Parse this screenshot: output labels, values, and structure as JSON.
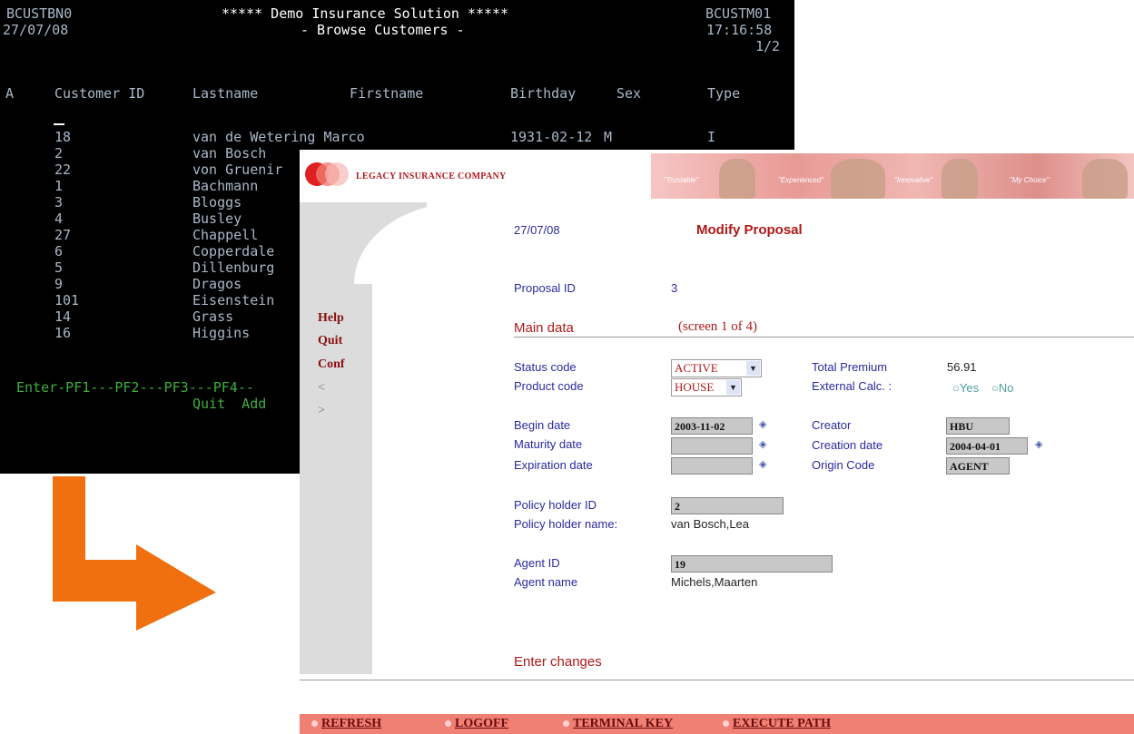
{
  "terminal": {
    "program_id": "BCUSTBN0",
    "date": "27/07/08",
    "title": "***** Demo Insurance Solution *****",
    "subtitle": "- Browse Customers -",
    "screen_id": "BCUSTM01",
    "time": "17:16:58",
    "page": "1/2",
    "headers": {
      "action": "A",
      "customer_id": "Customer ID",
      "lastname": "Lastname",
      "firstname": "Firstname",
      "birthday": "Birthday",
      "sex": "Sex",
      "type": "Type"
    },
    "rows": [
      {
        "id": "18",
        "name": "van de Wetering Marco",
        "birthday": "1931-02-12",
        "sex": "M",
        "type": "I"
      },
      {
        "id": "2",
        "name": "van Bosch",
        "birthday": "",
        "sex": "",
        "type": ""
      },
      {
        "id": "22",
        "name": "von Gruenir",
        "birthday": "",
        "sex": "",
        "type": ""
      },
      {
        "id": "1",
        "name": "Bachmann",
        "birthday": "",
        "sex": "",
        "type": ""
      },
      {
        "id": "3",
        "name": "Bloggs",
        "birthday": "",
        "sex": "",
        "type": ""
      },
      {
        "id": "4",
        "name": "Busley",
        "birthday": "",
        "sex": "",
        "type": ""
      },
      {
        "id": "27",
        "name": "Chappell",
        "birthday": "",
        "sex": "",
        "type": ""
      },
      {
        "id": "6",
        "name": "Copperdale",
        "birthday": "",
        "sex": "",
        "type": ""
      },
      {
        "id": "5",
        "name": "Dillenburg",
        "birthday": "",
        "sex": "",
        "type": ""
      },
      {
        "id": "9",
        "name": "Dragos",
        "birthday": "",
        "sex": "",
        "type": ""
      },
      {
        "id": "101",
        "name": "Eisenstein",
        "birthday": "",
        "sex": "",
        "type": ""
      },
      {
        "id": "14",
        "name": "Grass",
        "birthday": "",
        "sex": "",
        "type": ""
      },
      {
        "id": "16",
        "name": "Higgins",
        "birthday": "",
        "sex": "",
        "type": ""
      }
    ],
    "pf_line": "Enter-PF1---PF2---PF3---PF4--",
    "pf_labels": "Quit  Add"
  },
  "web": {
    "company": "LEGACY INSURANCE COMPANY",
    "slogans": [
      "\"Trustable\"",
      "\"Experienced\"",
      "\"Innovative\"",
      "\"My Choice\""
    ],
    "date": "27/07/08",
    "page_title": "Modify Proposal",
    "side_menu": [
      "Help",
      "Quit",
      "Conf",
      "<",
      ">"
    ],
    "proposal_id_label": "Proposal ID",
    "proposal_id": "3",
    "section": "Main data",
    "screen_info": "(screen 1 of 4)",
    "fields": {
      "status_code_label": "Status code",
      "status_code": "ACTIVE",
      "product_code_label": "Product code",
      "product_code": "HOUSE",
      "total_premium_label": "Total Premium",
      "total_premium": "56.91",
      "external_calc_label": "External Calc. :",
      "yes": "Yes",
      "no": "No",
      "begin_date_label": "Begin date",
      "begin_date": "2003-11-02",
      "maturity_date_label": "Maturity date",
      "maturity_date": "",
      "expiration_date_label": "Expiration date",
      "expiration_date": "",
      "creator_label": "Creator",
      "creator": "HBU",
      "creation_date_label": "Creation date",
      "creation_date": "2004-04-01",
      "origin_code_label": "Origin Code",
      "origin_code": "AGENT",
      "policy_holder_id_label": "Policy holder ID",
      "policy_holder_id": "2",
      "policy_holder_name_label": "Policy holder name:",
      "policy_holder_name": "van Bosch,Lea",
      "agent_id_label": "Agent ID",
      "agent_id": "19",
      "agent_name_label": "Agent name",
      "agent_name": "Michels,Maarten"
    },
    "message": "Enter changes",
    "bottom_buttons": [
      "REFRESH",
      "LOGOFF",
      "TERMINAL KEY",
      "EXECUTE PATH"
    ]
  },
  "colors": {
    "arrow": "#f07010",
    "accent_red": "#b01818",
    "bottom_bar": "#f07f74"
  }
}
